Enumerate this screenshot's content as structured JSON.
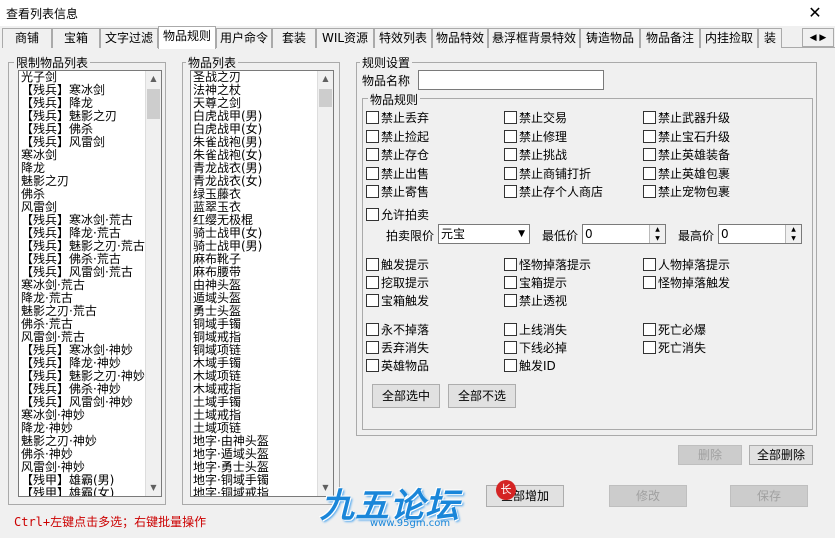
{
  "window": {
    "title": "查看列表信息",
    "close_glyph": "✕"
  },
  "tabs": [
    "商铺",
    "宝箱",
    "文字过滤",
    "物品规则",
    "用户命令",
    "套装",
    "WIL资源",
    "特效列表",
    "物品特效",
    "悬浮框背景特效",
    "铸造物品",
    "物品备注",
    "内挂捡取",
    "装"
  ],
  "active_tab": 3,
  "restricted_list": {
    "label": "限制物品列表",
    "items": [
      "光子剑",
      "【残兵】寒冰剑",
      "【残兵】降龙",
      "【残兵】魅影之刃",
      "【残兵】佛杀",
      "【残兵】风雷剑",
      "寒冰剑",
      "降龙",
      "魅影之刃",
      "佛杀",
      "风雷剑",
      "【残兵】寒冰剑·荒古",
      "【残兵】降龙·荒古",
      "【残兵】魅影之刃·荒古",
      "【残兵】佛杀·荒古",
      "【残兵】风雷剑·荒古",
      "寒冰剑·荒古",
      "降龙·荒古",
      "魅影之刃·荒古",
      "佛杀·荒古",
      "风雷剑·荒古",
      "【残兵】寒冰剑·神妙",
      "【残兵】降龙·神妙",
      "【残兵】魅影之刃·神妙",
      "【残兵】佛杀·神妙",
      "【残兵】风雷剑·神妙",
      "寒冰剑·神妙",
      "降龙·神妙",
      "魅影之刃·神妙",
      "佛杀·神妙",
      "风雷剑·神妙",
      "【残甲】雄霸(男)",
      "【残甲】雄霸(女)",
      "【残甲】帝珑(男)",
      "【残甲】帝珑(女)"
    ]
  },
  "item_list": {
    "label": "物品列表",
    "items": [
      "圣战之刃",
      "法神之杖",
      "天尊之剑",
      "白虎战甲(男)",
      "白虎战甲(女)",
      "朱雀战袍(男)",
      "朱雀战袍(女)",
      "青龙战衣(男)",
      "青龙战衣(女)",
      "绿玉藤衣",
      "蓝翠玉衣",
      "红缨无极棍",
      "骑士战甲(女)",
      "骑士战甲(男)",
      "麻布靴子",
      "麻布腰带",
      "由神头盔",
      "遁域头盔",
      "勇士头盔",
      "铜域手镯",
      "铜域戒指",
      "铜域项链",
      "木域手镯",
      "木域项链",
      "木域戒指",
      "土域手镯",
      "土域戒指",
      "土域项链",
      "地字·由神头盔",
      "地字·遁域头盔",
      "地字·勇士头盔",
      "地字·铜域手镯",
      "地字·铜域戒指",
      "地字·铜域项链",
      "地字·木域手镯",
      "地字·木域项链"
    ]
  },
  "rules": {
    "group_label": "规则设置",
    "name_label": "物品名称",
    "name_value": "",
    "subgroup_label": "物品规则",
    "checks_main": [
      "禁止丢弃",
      "禁止交易",
      "禁止武器升级",
      "禁止捡起",
      "禁止修理",
      "禁止宝石升级",
      "禁止存仓",
      "禁止挑战",
      "禁止英雄装备",
      "禁止出售",
      "禁止商铺打折",
      "禁止英雄包裹",
      "禁止寄售",
      "禁止存个人商店",
      "禁止宠物包裹"
    ],
    "auction_check": "允许拍卖",
    "auction_limit_label": "拍卖限价",
    "auction_currency": "元宝",
    "min_price_label": "最低价",
    "min_price": "0",
    "max_price_label": "最高价",
    "max_price": "0",
    "checks_trigger": [
      "触发提示",
      "怪物掉落提示",
      "人物掉落提示",
      "挖取提示",
      "宝箱提示",
      "怪物掉落触发",
      "宝箱触发",
      "禁止透视"
    ],
    "checks_misc": [
      "永不掉落",
      "上线消失",
      "死亡必爆",
      "丢弃消失",
      "下线必掉",
      "死亡消失",
      "英雄物品",
      "触发ID"
    ],
    "select_all": "全部选中",
    "select_none": "全部不选"
  },
  "actions": {
    "delete": "删除",
    "delete_all": "全部删除",
    "add_all": "全部增加",
    "modify": "修改",
    "save": "保存"
  },
  "hint": "Ctrl+左键点击多选；右键批量操作",
  "watermark": {
    "logo": "九五论坛",
    "url": "www.95gm.com",
    "seal": "长"
  },
  "colors": {
    "hint": "#cc0000",
    "logo": "#1a86d9"
  }
}
